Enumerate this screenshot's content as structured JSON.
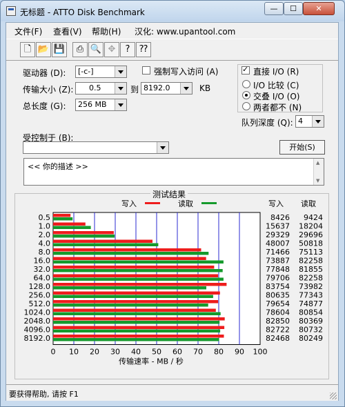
{
  "window": {
    "title": "无标题 - ATTO Disk Benchmark",
    "min": "—",
    "max": "☐",
    "close": "✕"
  },
  "menu": {
    "file": "文件(F)",
    "view": "查看(V)",
    "help": "帮助(H)",
    "credit": "汉化: www.upantool.com"
  },
  "toolbar": {
    "icons": [
      "new-file-icon",
      "open-folder-icon",
      "save-icon",
      "print-icon",
      "print-preview-icon",
      "move-icon",
      "help-icon",
      "context-help-icon"
    ]
  },
  "settings": {
    "drive_label": "驱动器 (D):",
    "drive_value": "[-c-]",
    "transfer_label": "传输大小 (Z):",
    "transfer_from": "0.5",
    "to_label": "到",
    "transfer_to": "8192.0",
    "kb_label": "KB",
    "length_label": "总长度 (G):",
    "length_value": "256 MB",
    "force_write_label": "强制写入访问 (A)",
    "direct_io_label": "直接 I/O (R)",
    "io_compare_label": "I/O 比较 (C)",
    "overlap_io_label": "交叠 I/O (O)",
    "neither_label": "两者都不 (N)",
    "queue_label": "队列深度 (Q):",
    "queue_value": "4",
    "controlled_by_label": "受控制于 (B):",
    "controlled_by_value": "",
    "start_button": "开始(S)"
  },
  "description": {
    "text": "<<    你的描述    >>"
  },
  "results": {
    "title": "测试结果",
    "legend_write": "写入",
    "legend_read": "读取",
    "col_write": "写入",
    "col_read": "读取",
    "xlabel": "传输速率 - MB / 秒"
  },
  "colors": {
    "write": "#ee1c1c",
    "read": "#159a2c",
    "grid": "#2a2ad0"
  },
  "chart_data": {
    "type": "bar",
    "orientation": "horizontal",
    "categories": [
      "0.5",
      "1.0",
      "2.0",
      "4.0",
      "8.0",
      "16.0",
      "32.0",
      "64.0",
      "128.0",
      "256.0",
      "512.0",
      "1024.0",
      "2048.0",
      "4096.0",
      "8192.0"
    ],
    "series": [
      {
        "name": "写入",
        "values": [
          8.4,
          15.6,
          29.3,
          48.0,
          71.5,
          73.9,
          77.8,
          79.7,
          83.8,
          80.6,
          79.7,
          78.6,
          82.9,
          82.7,
          82.5
        ]
      },
      {
        "name": "读取",
        "values": [
          9.4,
          18.2,
          29.7,
          50.8,
          75.1,
          82.3,
          81.9,
          82.3,
          74.0,
          77.3,
          74.9,
          80.9,
          80.4,
          80.7,
          80.2
        ]
      }
    ],
    "table": {
      "write": [
        "8426",
        "15637",
        "29329",
        "48007",
        "71466",
        "73887",
        "77848",
        "79706",
        "83754",
        "80635",
        "79654",
        "78604",
        "82850",
        "82722",
        "82468"
      ],
      "read": [
        "9424",
        "18204",
        "29696",
        "50818",
        "75113",
        "82258",
        "81855",
        "82258",
        "73982",
        "77343",
        "74877",
        "80854",
        "80369",
        "80732",
        "80249"
      ]
    },
    "xticks": [
      "0",
      "10",
      "20",
      "30",
      "40",
      "50",
      "60",
      "70",
      "80",
      "90",
      "100"
    ],
    "xlim": [
      0,
      100
    ],
    "xlabel": "传输速率 - MB / 秒",
    "grid": true,
    "legend_position": "top"
  },
  "status": {
    "text": "要获得帮助, 请按 F1"
  }
}
